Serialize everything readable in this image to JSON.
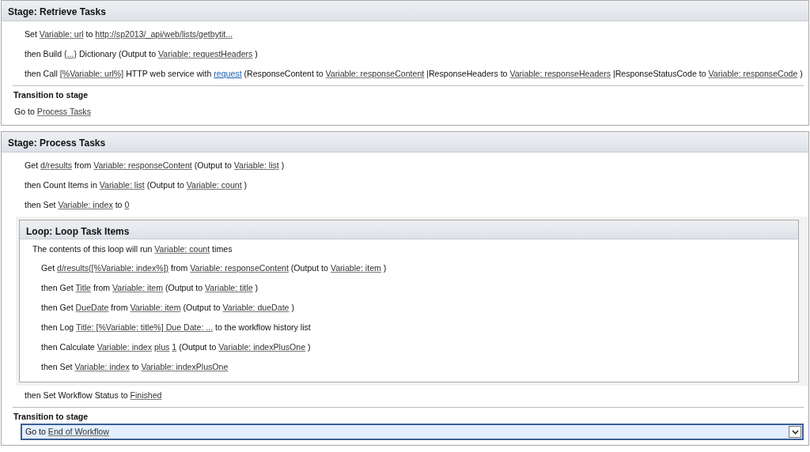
{
  "stages": [
    {
      "title": "Stage: Retrieve Tasks",
      "actions": [
        {
          "kind": "action",
          "segments": [
            {
              "kind": "text",
              "text": "Set "
            },
            {
              "kind": "link",
              "text": "Variable: url"
            },
            {
              "kind": "text",
              "text": " to "
            },
            {
              "kind": "link",
              "text": "http://sp2013/_api/web/lists/getbytit..."
            }
          ]
        },
        {
          "kind": "action",
          "segments": [
            {
              "kind": "text",
              "text": "then Build "
            },
            {
              "kind": "link",
              "text": "{...}"
            },
            {
              "kind": "text",
              "text": " Dictionary (Output to "
            },
            {
              "kind": "link",
              "text": "Variable: requestHeaders"
            },
            {
              "kind": "text",
              "text": " )"
            }
          ]
        },
        {
          "kind": "action",
          "segments": [
            {
              "kind": "text",
              "text": "then Call "
            },
            {
              "kind": "link",
              "text": "[%Variable: url%]"
            },
            {
              "kind": "text",
              "text": " HTTP web service with "
            },
            {
              "kind": "hyperlink",
              "text": "request"
            },
            {
              "kind": "text",
              "text": " (ResponseContent to "
            },
            {
              "kind": "link",
              "text": "Variable: responseContent"
            },
            {
              "kind": "text",
              "text": " |ResponseHeaders to "
            },
            {
              "kind": "link",
              "text": "Variable: responseHeaders"
            },
            {
              "kind": "text",
              "text": " |ResponseStatusCode to "
            },
            {
              "kind": "link",
              "text": "Variable: responseCode"
            },
            {
              "kind": "text",
              "text": " )"
            }
          ]
        }
      ],
      "transition": {
        "heading": "Transition to stage",
        "lines": [
          {
            "selected": false,
            "segments": [
              {
                "kind": "text",
                "text": "Go to "
              },
              {
                "kind": "link",
                "text": "Process Tasks"
              }
            ]
          }
        ]
      }
    },
    {
      "title": "Stage: Process Tasks",
      "actions": [
        {
          "kind": "action",
          "segments": [
            {
              "kind": "text",
              "text": "Get "
            },
            {
              "kind": "link",
              "text": "d/results"
            },
            {
              "kind": "text",
              "text": " from "
            },
            {
              "kind": "link",
              "text": "Variable: responseContent"
            },
            {
              "kind": "text",
              "text": " (Output to "
            },
            {
              "kind": "link",
              "text": "Variable: list"
            },
            {
              "kind": "text",
              "text": " )"
            }
          ]
        },
        {
          "kind": "action",
          "segments": [
            {
              "kind": "text",
              "text": "then Count Items in "
            },
            {
              "kind": "link",
              "text": "Variable: list"
            },
            {
              "kind": "text",
              "text": " (Output to "
            },
            {
              "kind": "link",
              "text": "Variable: count"
            },
            {
              "kind": "text",
              "text": " )"
            }
          ]
        },
        {
          "kind": "action",
          "segments": [
            {
              "kind": "text",
              "text": "then Set "
            },
            {
              "kind": "link",
              "text": "Variable: index"
            },
            {
              "kind": "text",
              "text": " to "
            },
            {
              "kind": "link",
              "text": "0"
            }
          ]
        },
        {
          "kind": "loop",
          "title": "Loop: Loop Task Items",
          "summary": [
            {
              "kind": "text",
              "text": "The contents of this loop will run "
            },
            {
              "kind": "link",
              "text": "Variable: count"
            },
            {
              "kind": "text",
              "text": " times"
            }
          ],
          "actions": [
            {
              "kind": "action",
              "segments": [
                {
                  "kind": "text",
                  "text": "Get "
                },
                {
                  "kind": "link",
                  "text": "d/results([%Variable: index%])"
                },
                {
                  "kind": "text",
                  "text": " from "
                },
                {
                  "kind": "link",
                  "text": "Variable: responseContent"
                },
                {
                  "kind": "text",
                  "text": " (Output to "
                },
                {
                  "kind": "link",
                  "text": "Variable: item"
                },
                {
                  "kind": "text",
                  "text": " )"
                }
              ]
            },
            {
              "kind": "action",
              "segments": [
                {
                  "kind": "text",
                  "text": "then Get "
                },
                {
                  "kind": "link",
                  "text": "Title"
                },
                {
                  "kind": "text",
                  "text": " from "
                },
                {
                  "kind": "link",
                  "text": "Variable: item"
                },
                {
                  "kind": "text",
                  "text": " (Output to "
                },
                {
                  "kind": "link",
                  "text": "Variable: title"
                },
                {
                  "kind": "text",
                  "text": " )"
                }
              ]
            },
            {
              "kind": "action",
              "segments": [
                {
                  "kind": "text",
                  "text": "then Get "
                },
                {
                  "kind": "link",
                  "text": "DueDate"
                },
                {
                  "kind": "text",
                  "text": " from "
                },
                {
                  "kind": "link",
                  "text": "Variable: item"
                },
                {
                  "kind": "text",
                  "text": " (Output to "
                },
                {
                  "kind": "link",
                  "text": "Variable: dueDate"
                },
                {
                  "kind": "text",
                  "text": " )"
                }
              ]
            },
            {
              "kind": "action",
              "segments": [
                {
                  "kind": "text",
                  "text": "then Log "
                },
                {
                  "kind": "link",
                  "text": "Title: [%Variable: title%] Due Date: ..."
                },
                {
                  "kind": "text",
                  "text": " to the workflow history list"
                }
              ]
            },
            {
              "kind": "action",
              "segments": [
                {
                  "kind": "text",
                  "text": "then Calculate "
                },
                {
                  "kind": "link",
                  "text": "Variable: index"
                },
                {
                  "kind": "link",
                  "text": "plus",
                  "spaced": true
                },
                {
                  "kind": "link",
                  "text": "1",
                  "spaced": true
                },
                {
                  "kind": "text",
                  "text": " (Output to "
                },
                {
                  "kind": "link",
                  "text": "Variable: indexPlusOne"
                },
                {
                  "kind": "text",
                  "text": " )"
                }
              ]
            },
            {
              "kind": "action",
              "segments": [
                {
                  "kind": "text",
                  "text": "then Set "
                },
                {
                  "kind": "link",
                  "text": "Variable: index"
                },
                {
                  "kind": "text",
                  "text": " to "
                },
                {
                  "kind": "link",
                  "text": "Variable: indexPlusOne"
                }
              ]
            }
          ]
        },
        {
          "kind": "action",
          "segments": [
            {
              "kind": "text",
              "text": "then Set Workflow Status to "
            },
            {
              "kind": "link",
              "text": "Finished"
            }
          ]
        }
      ],
      "transition": {
        "heading": "Transition to stage",
        "lines": [
          {
            "selected": true,
            "segments": [
              {
                "kind": "text",
                "text": "Go to "
              },
              {
                "kind": "link",
                "text": "End of Workflow"
              }
            ]
          }
        ]
      }
    }
  ]
}
